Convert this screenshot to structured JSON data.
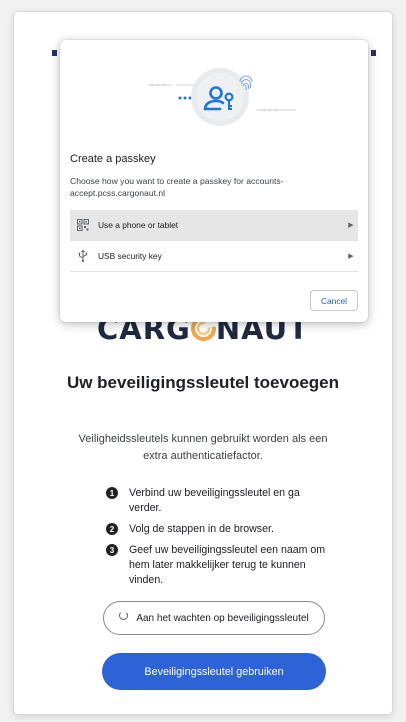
{
  "dialog": {
    "title": "Create a passkey",
    "description": "Choose how you want to create a passkey for accounts-accept.pcss.cargonaut.nl",
    "options": [
      {
        "label": "Use a phone or tablet",
        "icon": "qr-code-icon"
      },
      {
        "label": "USB security key",
        "icon": "usb-icon"
      }
    ],
    "cancel_label": "Cancel",
    "hero_icon": "passkey-user-key-icon"
  },
  "brand": {
    "logo_left": "CARG",
    "logo_right": "NAUT",
    "logo_colors": {
      "text": "#1f2940",
      "o_outer": "#f4a64a",
      "o_inner": "#f7c98d"
    }
  },
  "main": {
    "heading": "Uw beveiligingssleutel toevoegen",
    "intro": "Veiligheidssleutels kunnen gebruikt worden als een extra authenticatiefactor.",
    "steps": [
      {
        "num": "1",
        "text": "Verbind uw beveiligingssleutel en ga verder."
      },
      {
        "num": "2",
        "text": "Volg de stappen in de browser."
      },
      {
        "num": "3",
        "text": "Geef uw beveiligingssleutel een naam om hem later makkelijker terug te kunnen vinden."
      }
    ],
    "waiting_label": "Aan het wachten op beveiligingssleutel",
    "use_key_label": "Beveiligingssleutel gebruiken"
  },
  "colors": {
    "primary_button": "#2d63d6",
    "cancel_text": "#1a5fd0",
    "selected_option_bg": "#e6e6e6"
  }
}
